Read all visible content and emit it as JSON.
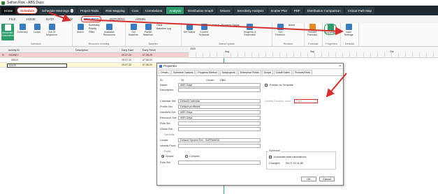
{
  "window": {
    "title": "Safran Risk - ABS Days"
  },
  "navbar": {
    "items": [
      {
        "label": "Home",
        "kind": "home"
      },
      {
        "label": "Schedule",
        "kind": "schedule"
      },
      {
        "label": "Schedule Warnings",
        "badge": "4",
        "kind": "normal"
      },
      {
        "label": "Project Risks",
        "kind": "normal"
      },
      {
        "label": "Risk Mapping",
        "kind": "normal"
      },
      {
        "label": "Cost",
        "kind": "normal"
      },
      {
        "label": "Correlations",
        "kind": "normal"
      },
      {
        "label": "Analysis",
        "kind": "green"
      },
      {
        "label": "Distribution Graph",
        "kind": "normal"
      },
      {
        "label": "Drivers",
        "kind": "normal"
      },
      {
        "label": "Sensitivity Analysis",
        "kind": "normal"
      },
      {
        "label": "Scatter Plot",
        "kind": "normal"
      },
      {
        "label": "PDF",
        "kind": "normal"
      },
      {
        "label": "Distribution Comparison",
        "kind": "normal"
      },
      {
        "label": "Critical Path Map",
        "kind": "normal"
      }
    ]
  },
  "tabs": [
    {
      "label": "FILE",
      "active": false
    },
    {
      "label": "HOME",
      "active": false
    },
    {
      "label": "DATA",
      "active": false
    },
    {
      "label": "VIEW",
      "active": false
    },
    {
      "label": "PROJECT",
      "active": true
    },
    {
      "label": "REPORTS",
      "active": false
    },
    {
      "label": "ADMIN",
      "active": false
    }
  ],
  "ribbon": {
    "schedule_group": "Schedule",
    "auto_calc": "Automatic Calculation",
    "summary": "Summary",
    "loops": "Loops",
    "out_of_sequence": "Out Of Sequence",
    "resource_group": "Resource Leveling",
    "active": "Active",
    "summary_small": "Summary",
    "priority": "Priority",
    "filter": "Filter",
    "available_resources": "Available Resources",
    "baseline_group": "Baseline",
    "set_baseline": "Set Baseline",
    "partial_baseline": "Partial Baseline",
    "clear": "Clear",
    "baseline_log": "Baseline Log",
    "status_group": "Status Update",
    "set_status": "Set Status",
    "current_schedule": "Current Schedule",
    "actual": "Actual",
    "progress_status": "Progress Status",
    "progress_expended": "Progress & Expended",
    "revision_group": "Revision",
    "set_revision": "Set Revision",
    "annul": "Annul",
    "forecast_group": "Forecast",
    "perform_forecast": "Perform Forecast",
    "properties_group": "Properties",
    "properties": "Properties",
    "defaults_group": "Defaults",
    "user_settings": "User Settings"
  },
  "grid": {
    "columns": [
      "Activity ID",
      "Description",
      "Early Start",
      "Early Finish"
    ],
    "rows": [
      {
        "id": "<NONE>",
        "desc": "",
        "start": "29.07.20",
        "finish": "07.08.20",
        "style": "pink"
      },
      {
        "id": "00010",
        "desc": "",
        "start": "29.07.20",
        "finish": "07.08.20",
        "style": "plain"
      },
      {
        "id": "00020",
        "desc": "",
        "start": "29.07.20",
        "finish": "07.08.20",
        "style": "yellow"
      }
    ]
  },
  "timeline": {
    "year": "2020",
    "months": [
      "Aug",
      "Sep",
      "Oct"
    ]
  },
  "dialog": {
    "title": "Properties",
    "tabs": [
      "Details",
      "Schedule Options",
      "Progress Method",
      "Subprojects",
      "Enterprise Fields",
      "Scope",
      "Cutoff Dates",
      "Pictures/Texts"
    ],
    "id_label": "ID:",
    "id_value": "19",
    "owner_label": "Owner:",
    "owner_value": "DBA",
    "name_label": "Name:",
    "name_value": "ABS Days",
    "publish_template": "Publish as Template",
    "description_label": "Description:",
    "calendar_label": "Calendar Set:",
    "calendar_value": "Default Calendar",
    "profile_label": "Profile Set:",
    "profile_value": "Default profileset",
    "userfield_label": "Userfield Set:",
    "userfield_value": "ABS Days",
    "resource_label": "Resource Set:",
    "resource_value": "ABS Days",
    "rule_label": "Rule Set:",
    "global_label": "Global Set:",
    "symbols_header": "Symbols",
    "locale_label": "Locale:",
    "locale_value": "Default Symbol Set - SAFRANSA",
    "inherits_label": "Inherits From:",
    "rules_header": "Rules",
    "simple": "Simple",
    "complex": "Complex",
    "rule_set2_label": "Rule Set:",
    "limited_duration_label": "Limited Duration units:",
    "limited_duration_value": "Days",
    "schedule_header": "Schedule",
    "auto_date_calc": "Automatic date calculations",
    "changed_label": "Changed:",
    "changed_value": "29.07.20 11:50",
    "ok": "OK",
    "cancel": "Cancel"
  }
}
